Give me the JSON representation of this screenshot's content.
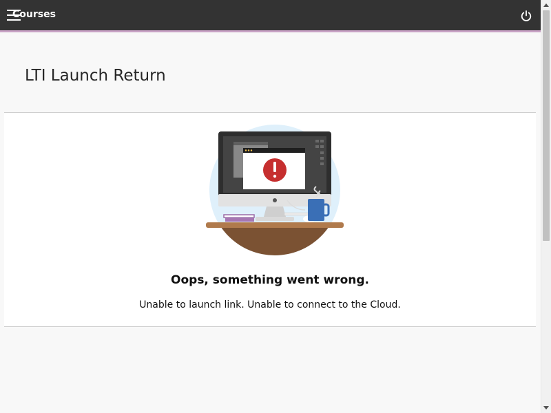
{
  "header": {
    "app_title": "Courses"
  },
  "page": {
    "title": "LTI Launch Return"
  },
  "error": {
    "heading": "Oops, something went wrong.",
    "message": "Unable to launch link. Unable to connect to the Cloud."
  },
  "icons": {
    "menu": "hamburger-menu-icon",
    "power": "power-icon",
    "illustration": "computer-error-illustration",
    "alert": "exclamation-alert-icon"
  },
  "colors": {
    "topbar_bg": "#333333",
    "topbar_accent": "#c9a3c6",
    "alert_red": "#c62f2f",
    "page_bg": "#f8f8f8"
  }
}
